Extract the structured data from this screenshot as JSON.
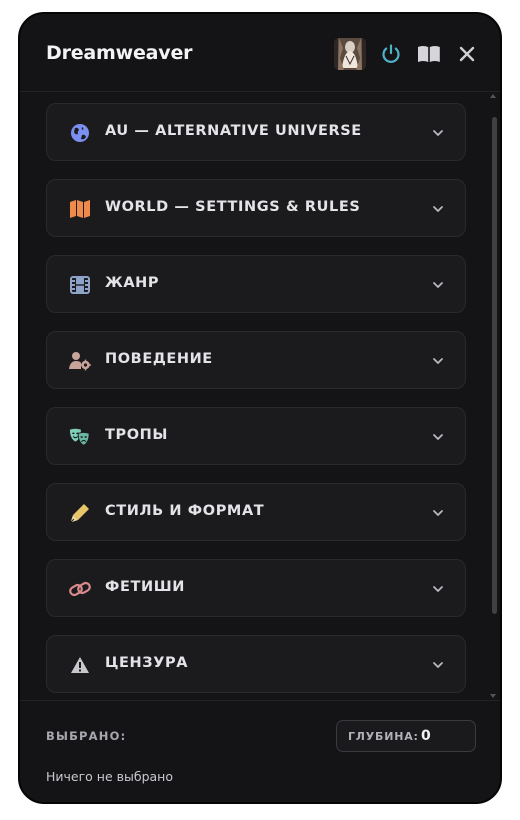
{
  "app": {
    "title": "Dreamweaver"
  },
  "header": {
    "avatar_icon": "avatar-image",
    "power_icon": "power-icon",
    "book_icon": "book-open-icon",
    "close_icon": "close-icon",
    "power_color": "#4fb3c8"
  },
  "sections": [
    {
      "label": "AU — ALTERNATIVE UNIVERSE",
      "icon": "globe-icon",
      "color": "#7b8ff0"
    },
    {
      "label": "WORLD — SETTINGS & RULES",
      "icon": "map-icon",
      "color": "#f08a4b"
    },
    {
      "label": "ЖАНР",
      "icon": "film-icon",
      "color": "#8fa3c8"
    },
    {
      "label": "ПОВЕДЕНИЕ",
      "icon": "user-gear-icon",
      "color": "#c9a49a"
    },
    {
      "label": "ТРОПЫ",
      "icon": "masks-icon",
      "color": "#7fcfb8"
    },
    {
      "label": "СТИЛЬ И ФОРМАТ",
      "icon": "pen-icon",
      "color": "#e8c46a"
    },
    {
      "label": "ФЕТИШИ",
      "icon": "link-icon",
      "color": "#d98b8b"
    },
    {
      "label": "ЦЕНЗУРА",
      "icon": "warning-icon",
      "color": "#c8c8cc"
    }
  ],
  "footer": {
    "selected_label": "ВЫБРАНО:",
    "depth_label": "ГЛУБИНА:",
    "depth_value": "0",
    "selected_text": "Ничего не выбрано"
  }
}
